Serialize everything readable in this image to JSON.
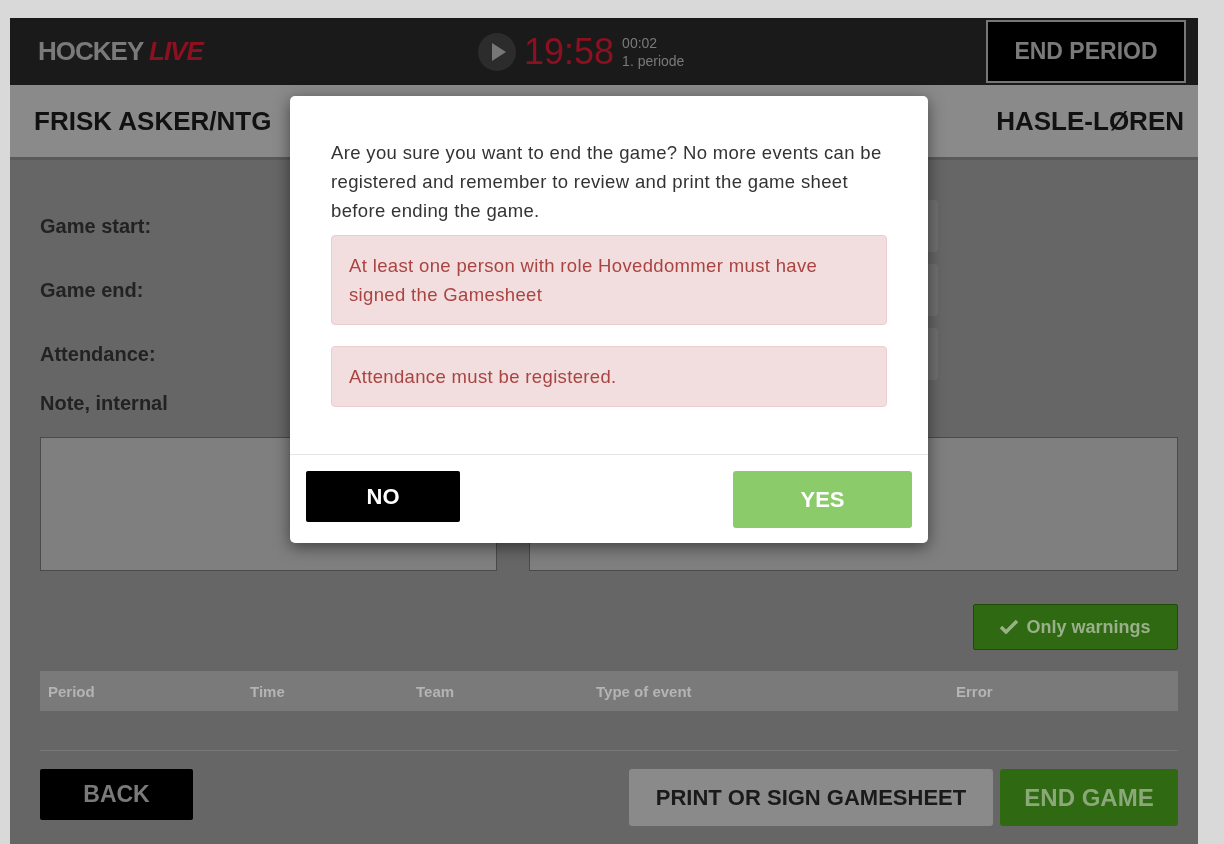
{
  "header": {
    "logo": {
      "main": "HOCKEY",
      "accent": "LIVE"
    },
    "clock": {
      "running": false,
      "time": "19:58",
      "elapsed": "00:02",
      "period": "1. periode"
    },
    "end_period_button": "END PERIOD"
  },
  "teams": {
    "home": "FRISK ASKER/NTG",
    "away": "HASLE-LØREN"
  },
  "form": {
    "fields": [
      {
        "label": "Game start:"
      },
      {
        "label": "Game end:"
      },
      {
        "label": "Attendance:"
      }
    ],
    "note_label": "Note, internal"
  },
  "filter_button": {
    "label": "Only warnings",
    "checked": true
  },
  "table": {
    "columns": [
      "Period",
      "Time",
      "Team",
      "Type of event",
      "Error"
    ]
  },
  "footer": {
    "back": "BACK",
    "print": "PRINT OR SIGN GAMESHEET",
    "end_game": "END GAME"
  },
  "dialog": {
    "message": "Are you sure you want to end the game? No more events can be registered and remember to review and print the game sheet before ending the game.",
    "errors": [
      "At least one person with role Hoveddommer must have signed the Gamesheet",
      "Attendance must be registered."
    ],
    "no": "NO",
    "yes": "YES"
  }
}
